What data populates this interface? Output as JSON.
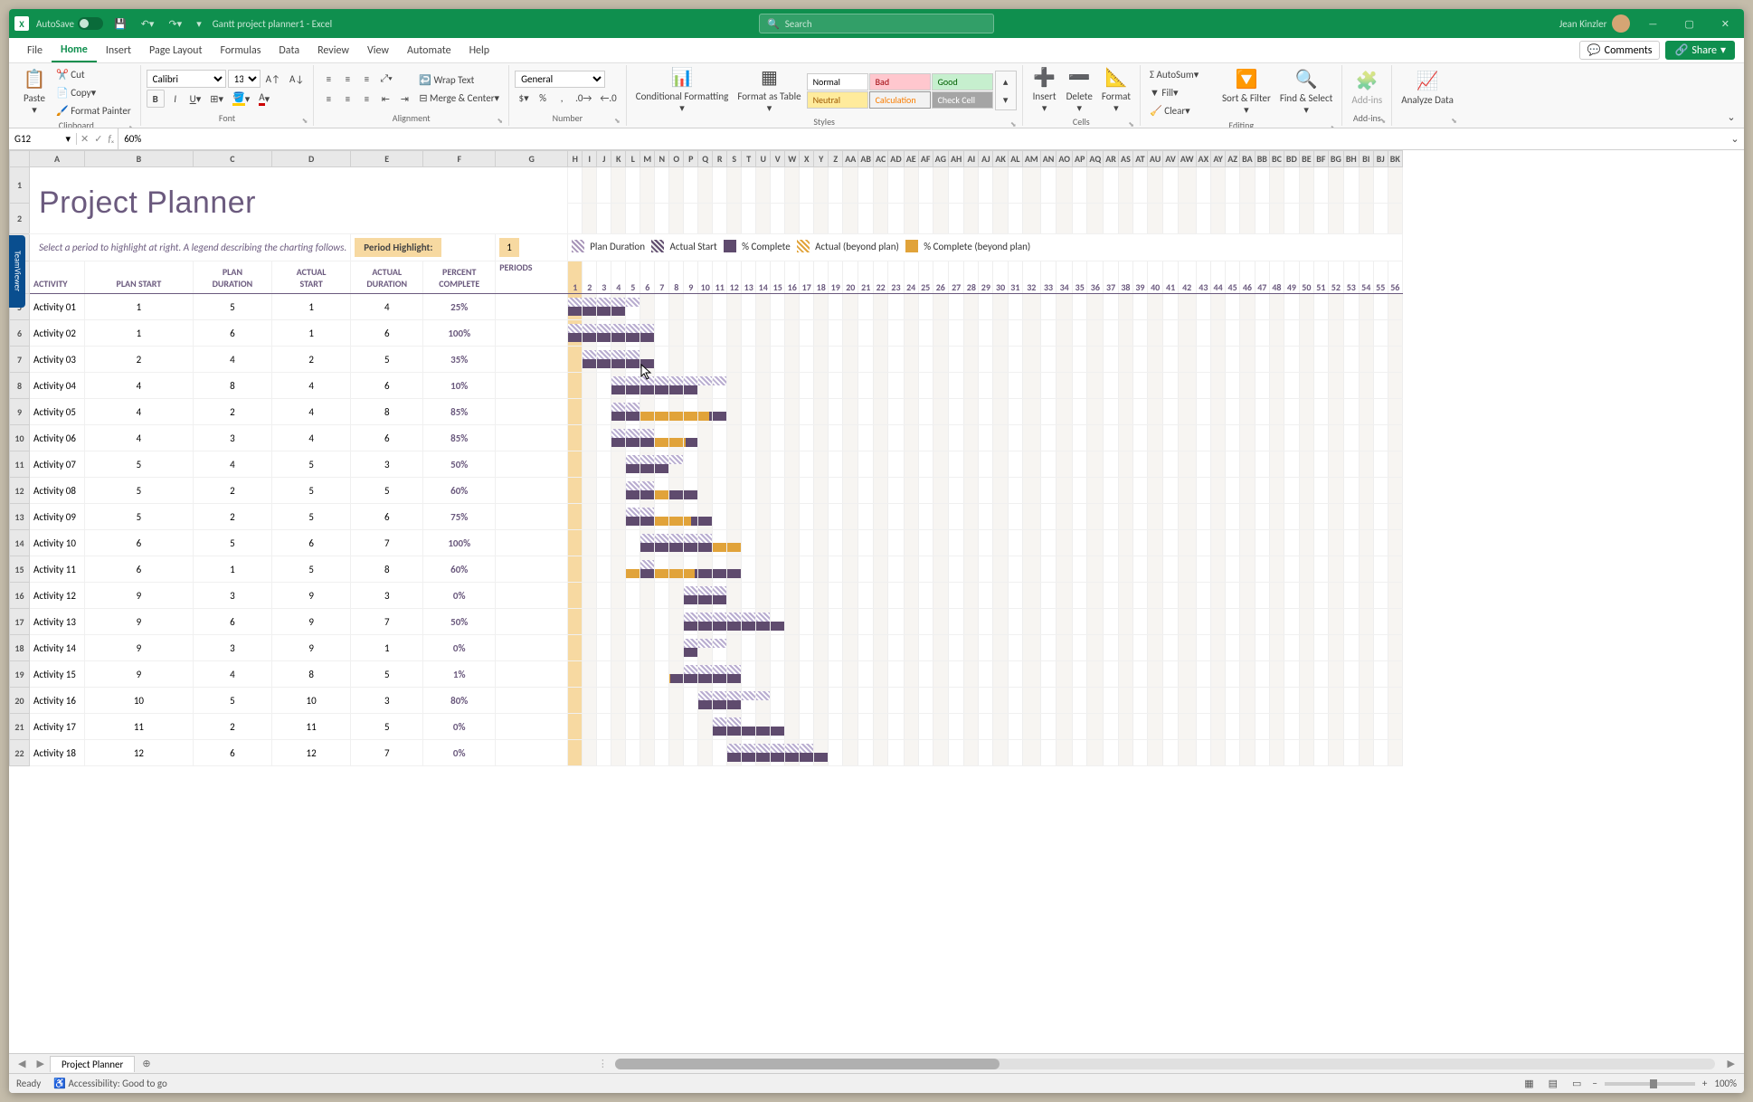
{
  "titlebar": {
    "autosave": "AutoSave",
    "docname": "Gantt project planner1 - Excel",
    "search": "Search",
    "user": "Jean Kinzler"
  },
  "tabs": [
    "File",
    "Home",
    "Insert",
    "Page Layout",
    "Formulas",
    "Data",
    "Review",
    "View",
    "Automate",
    "Help"
  ],
  "activeTab": "Home",
  "comments": "Comments",
  "share": "Share",
  "ribbon": {
    "clipboard": {
      "paste": "Paste",
      "cut": "Cut",
      "copy": "Copy",
      "painter": "Format Painter",
      "label": "Clipboard"
    },
    "font": {
      "name": "Calibri",
      "size": "13",
      "label": "Font"
    },
    "alignment": {
      "wrap": "Wrap Text",
      "merge": "Merge & Center",
      "label": "Alignment"
    },
    "number": {
      "format": "General",
      "label": "Number"
    },
    "styles": {
      "cond": "Conditional Formatting",
      "table": "Format as Table",
      "normal": "Normal",
      "bad": "Bad",
      "good": "Good",
      "neutral": "Neutral",
      "calc": "Calculation",
      "check": "Check Cell",
      "label": "Styles"
    },
    "cells": {
      "insert": "Insert",
      "delete": "Delete",
      "format": "Format",
      "label": "Cells"
    },
    "editing": {
      "autosum": "AutoSum",
      "fill": "Fill",
      "clear": "Clear",
      "sort": "Sort & Filter",
      "find": "Find & Select",
      "label": "Editing"
    },
    "addins": {
      "addins": "Add-ins",
      "label": "Add-ins"
    },
    "analyze": {
      "analyze": "Analyze Data"
    }
  },
  "formula": {
    "namebox": "G12",
    "value": "60%"
  },
  "columns": [
    "A",
    "B",
    "C",
    "D",
    "E",
    "F",
    "G",
    "H",
    "I",
    "J",
    "K",
    "L",
    "M",
    "N",
    "O",
    "P",
    "Q",
    "R",
    "S",
    "T",
    "U",
    "V",
    "W",
    "X",
    "Y",
    "Z",
    "AA",
    "AB",
    "AC",
    "AD",
    "AE",
    "AF",
    "AG",
    "AH",
    "AI",
    "AJ",
    "AK",
    "AL",
    "AM",
    "AN",
    "AO",
    "AP",
    "AQ",
    "AR",
    "AS",
    "AT",
    "AU",
    "AV",
    "AW",
    "AX",
    "AY",
    "AZ",
    "BA",
    "BB",
    "BC",
    "BD",
    "BE",
    "BF",
    "BG",
    "BH",
    "BI",
    "BJ",
    "BK"
  ],
  "planner": {
    "title": "Project Planner",
    "intro": "Select a period to highlight at right.  A legend describing the charting follows.",
    "periodHighlightLabel": "Period Highlight:",
    "periodHighlightValue": "1",
    "legend": {
      "plan": "Plan Duration",
      "astart": "Actual Start",
      "pct": "% Complete",
      "abeyond": "Actual (beyond plan)",
      "pbeyond": "% Complete (beyond plan)"
    },
    "headers": {
      "activity": "ACTIVITY",
      "pstart": "PLAN START",
      "pdur": "PLAN DURATION",
      "astart": "ACTUAL START",
      "adur": "ACTUAL DURATION",
      "pct": "PERCENT COMPLETE",
      "periods": "PERIODS"
    },
    "periodCount": 56,
    "rows": [
      {
        "a": "Activity 01",
        "ps": 1,
        "pd": 5,
        "as": 1,
        "ad": 4,
        "pct": "25%"
      },
      {
        "a": "Activity 02",
        "ps": 1,
        "pd": 6,
        "as": 1,
        "ad": 6,
        "pct": "100%"
      },
      {
        "a": "Activity 03",
        "ps": 2,
        "pd": 4,
        "as": 2,
        "ad": 5,
        "pct": "35%"
      },
      {
        "a": "Activity 04",
        "ps": 4,
        "pd": 8,
        "as": 4,
        "ad": 6,
        "pct": "10%"
      },
      {
        "a": "Activity 05",
        "ps": 4,
        "pd": 2,
        "as": 4,
        "ad": 8,
        "pct": "85%"
      },
      {
        "a": "Activity 06",
        "ps": 4,
        "pd": 3,
        "as": 4,
        "ad": 6,
        "pct": "85%"
      },
      {
        "a": "Activity 07",
        "ps": 5,
        "pd": 4,
        "as": 5,
        "ad": 3,
        "pct": "50%"
      },
      {
        "a": "Activity 08",
        "ps": 5,
        "pd": 2,
        "as": 5,
        "ad": 5,
        "pct": "60%"
      },
      {
        "a": "Activity 09",
        "ps": 5,
        "pd": 2,
        "as": 5,
        "ad": 6,
        "pct": "75%"
      },
      {
        "a": "Activity 10",
        "ps": 6,
        "pd": 5,
        "as": 6,
        "ad": 7,
        "pct": "100%"
      },
      {
        "a": "Activity 11",
        "ps": 6,
        "pd": 1,
        "as": 5,
        "ad": 8,
        "pct": "60%"
      },
      {
        "a": "Activity 12",
        "ps": 9,
        "pd": 3,
        "as": 9,
        "ad": 3,
        "pct": "0%"
      },
      {
        "a": "Activity 13",
        "ps": 9,
        "pd": 6,
        "as": 9,
        "ad": 7,
        "pct": "50%"
      },
      {
        "a": "Activity 14",
        "ps": 9,
        "pd": 3,
        "as": 9,
        "ad": 1,
        "pct": "0%"
      },
      {
        "a": "Activity 15",
        "ps": 9,
        "pd": 4,
        "as": 8,
        "ad": 5,
        "pct": "1%"
      },
      {
        "a": "Activity 16",
        "ps": 10,
        "pd": 5,
        "as": 10,
        "ad": 3,
        "pct": "80%"
      },
      {
        "a": "Activity 17",
        "ps": 11,
        "pd": 2,
        "as": 11,
        "ad": 5,
        "pct": "0%"
      },
      {
        "a": "Activity 18",
        "ps": 12,
        "pd": 6,
        "as": 12,
        "ad": 7,
        "pct": "0%"
      }
    ]
  },
  "sheetTabs": [
    "Project Planner"
  ],
  "status": {
    "ready": "Ready",
    "acc": "Accessibility: Good to go",
    "zoom": "100%"
  },
  "teamviewer": "TeamViewer"
}
